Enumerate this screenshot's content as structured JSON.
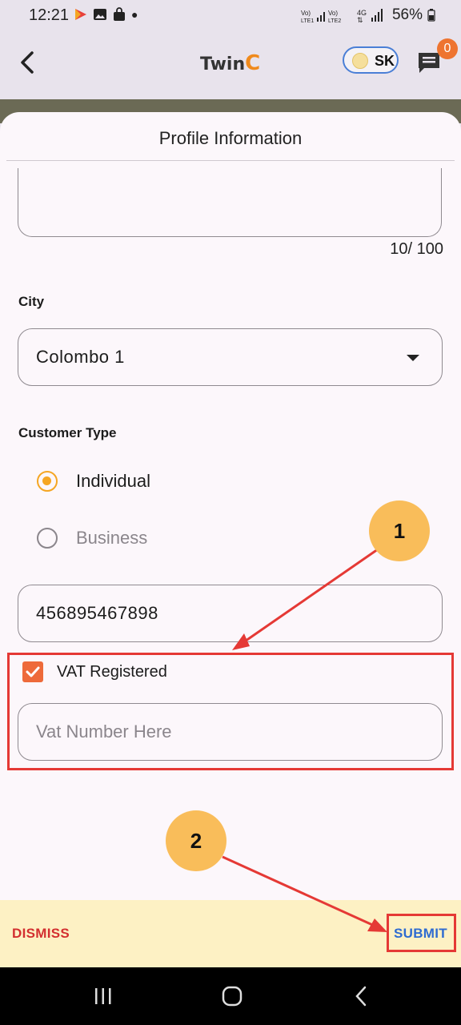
{
  "status_bar": {
    "time": "12:21",
    "battery": "56%"
  },
  "app_bar": {
    "logo_text": "Twin",
    "logo_accent": "C",
    "user_initials": "SK",
    "notification_count": "0"
  },
  "sheet": {
    "title": "Profile Information",
    "address_counter": "10/ 100",
    "city_label": "City",
    "city_value": "Colombo 1",
    "customer_type_label": "Customer Type",
    "customer_types": [
      {
        "label": "Individual",
        "selected": true
      },
      {
        "label": "Business",
        "selected": false
      }
    ],
    "id_number": "456895467898",
    "vat_label": "VAT Registered",
    "vat_checked": true,
    "vat_placeholder": "Vat Number Here"
  },
  "footer": {
    "dismiss_label": "DISMISS",
    "submit_label": "SUBMIT"
  },
  "annotations": {
    "callout_1": "1",
    "callout_2": "2"
  },
  "colors": {
    "accent": "#f5a623",
    "checkbox": "#ee6a3a",
    "dismiss": "#d32f2f",
    "submit": "#2e6bd1",
    "highlight": "#e53935"
  }
}
